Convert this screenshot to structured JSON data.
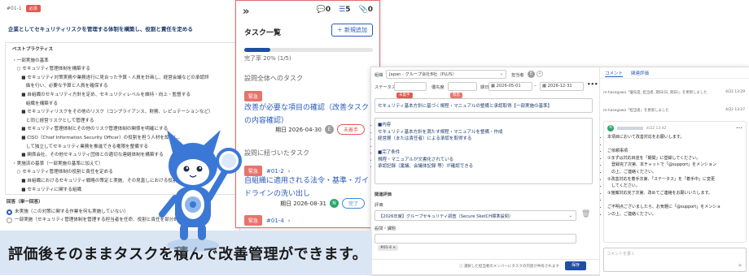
{
  "left": {
    "id": "#01-1",
    "badge": "必須",
    "title": "企業としてセキュリティリスクを管理する体制を構築し、役割と責任を定める",
    "bp_heading": "ベストプラクティス",
    "bp_lines": [
      "・一部実施の基準",
      "　○ セキュリティ管理体制を構築する",
      "　　■ セキュリティ対策実務や業務遂行に見合った予算・人員を計画し、経営会議などの承認評",
      "　　　価を行い、必要な予算と人員を確保する",
      "　　■ 自組織のセキュリティ方針を定め、セキュリティレベルを維持・向上・監督する",
      "　　　組織を構築する",
      "　　■ セキュリティリスクをその他のリスク（コンプライアンス、財務、レピュテーションなど）",
      "　　　と同じ経営リスクとして管理する",
      "　　■ セキュリティ管理体制とその他のリスク管理体制の関係を明確にする",
      "　　■ CISO（Chief Information Security Officer）の役割を担う人材を設置し、",
      "　　　して独立してセキュリティ業務を推進できる権限を整備する",
      "　　■ 関係会社、その他セキュリティ団体との適切な連絡体制を構築する",
      "・実施済の基準（一部実施の基準に加えて）",
      "　○ セキュリティ管理体制の役割と責任を定める",
      "　　■ 自組織におけるセキュリティ戦略の策定と実施、その見直しにおける役割",
      "　　■ セキュリティに関する組織"
    ],
    "answer_label": "回答（単一回答）",
    "options": [
      "未実施（この対策に関する作業を何も実施していない）",
      "一部実施（セキュリティ管理体制を管理する担当者を任命、役割と責任を部分的に定めている）"
    ]
  },
  "task": {
    "counts": {
      "comments": "0",
      "tasks": "5",
      "attachments": "0"
    },
    "title": "タスク一覧",
    "add_label": "新規追加",
    "progress_text": "完了率 20% (1/5)",
    "progress": 0.2,
    "section1": "設問全体へのタスク",
    "task1": {
      "tag": "緊急",
      "title": "改善が必要な項目の確認（改善タスクの内容確認）",
      "due": "期日 2026-04-30",
      "avatar": "E",
      "status": "未着手"
    },
    "section2": "設問に紐づいたタスク",
    "task2": {
      "tag": "緊急",
      "ref": "#01-2",
      "title": "自組織に適用される法令・基準・ガイドラインの洗い出し",
      "due": "期日 2026-08-31",
      "avatar": "N",
      "status": "完了"
    },
    "task3": {
      "tag": "緊急",
      "ref": "#01-4"
    }
  },
  "right": {
    "org_label": "組織",
    "org_value": "Japan - グループ会社B社（PLUS）",
    "assignee_label": "担当者",
    "assignee_avatar": "E",
    "status_label": "ステータス",
    "status_value": "未着手",
    "priority_label": "優先度",
    "priority_value": "緊急",
    "due_label": "期日",
    "date_from": "2026-05-01",
    "date_to": "2026-12-31",
    "more": "•••",
    "task_title": "セキュリティ基本方針に基づく規程・マニュアルの整備と承認取得【一部実施の基準】",
    "body": [
      "■内容",
      "セキュリティ基本方針を満たす規程・マニュアルを整備・作成",
      "経営層（または責任者）による承認を取得する",
      "",
      "■完了条件",
      "規程・マニュアルが文書化されている",
      "承認記録（稟議、会議体記録 等）が確認できる"
    ],
    "related_label": "関連評価",
    "eval_label": "評価",
    "eval_value": "【2026年度】グループセキュリティ調査（Secure SketCH標準設問）",
    "q_label": "設問・課題",
    "q_tag": "#01-4",
    "footer_note": "選択した担当者のメンバーにタスクの内容が共有されます",
    "save_label": "保存",
    "tabs": [
      "コメント",
      "関連評価"
    ],
    "activity": [
      {
        "text": "m-hasegawa「優先度, 担当者, 期日(日, 期日)」を更新しました",
        "time": "4/22 13:29"
      },
      {
        "text": "m-hasegawa「担当者」を更新しました",
        "time": "4/22 13:27"
      }
    ],
    "comment": {
      "avatar": "N",
      "time": "4/22 13:42",
      "lines": [
        "本項目において改善対応をお願いします。",
        "",
        "ご依頼事項",
        "①まずは対応目途を「期間」に登録してください。",
        "　登録完了次第、本チャットで「@support」をメンション",
        "　の上、ご連絡ください。",
        "②改善対応を着手次第、「ステータス」を「着手中」に変更",
        "　してください。",
        "③施策対応完了次第、改めてご連絡をお願いいたします。",
        "",
        "ご不明点ございましたら、お気軽に「@support」をメンショ",
        "ンの上、ご連絡ください。"
      ]
    },
    "comment_placeholder": "コメントを書く"
  },
  "banner": "評価後そのままタスクを積んで改善管理ができます。"
}
